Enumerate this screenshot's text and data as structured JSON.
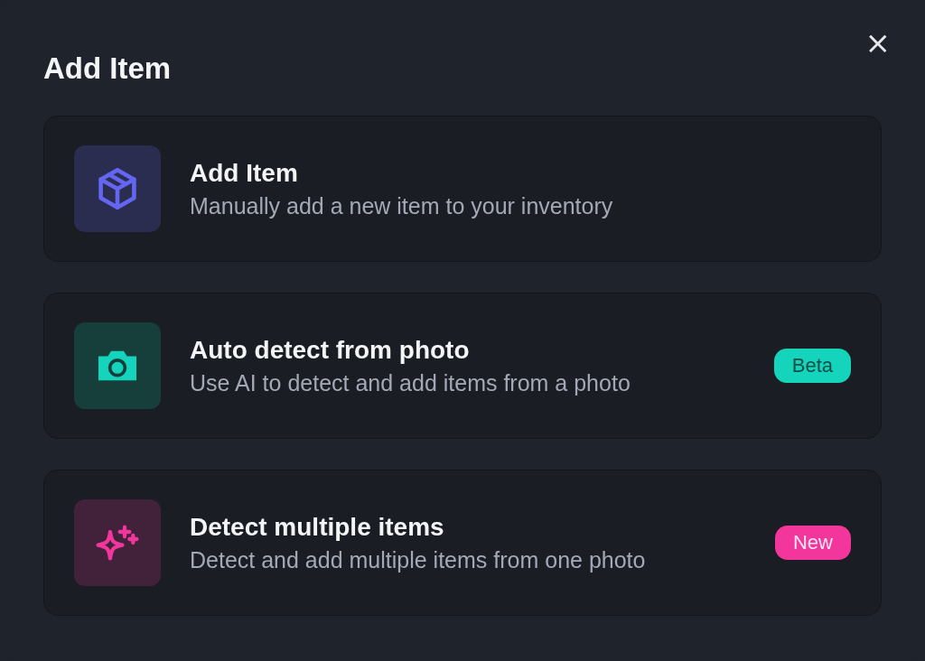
{
  "dialog": {
    "title": "Add Item",
    "close": "×"
  },
  "options": [
    {
      "kind": "box",
      "title": "Add Item",
      "description": "Manually add a new item to your inventory",
      "color": "#6366f1"
    },
    {
      "kind": "camera",
      "title": "Auto detect from photo",
      "description": "Use AI to detect and add items from a photo",
      "color": "#14d4bc",
      "badge": "Beta"
    },
    {
      "kind": "sparkles",
      "title": "Detect multiple items",
      "description": "Detect and add multiple items from one photo",
      "color": "#f2369b",
      "badge": "New"
    }
  ]
}
